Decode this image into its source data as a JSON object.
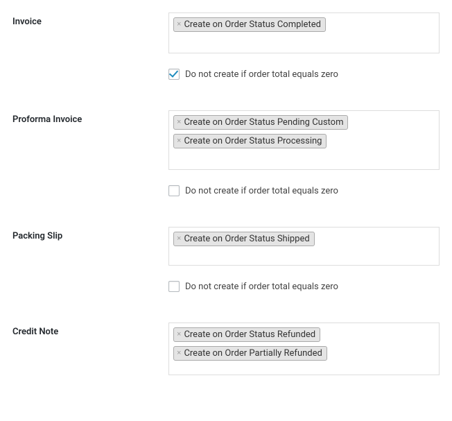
{
  "sections": {
    "invoice": {
      "label": "Invoice",
      "tags": [
        "Create on Order Status Completed"
      ],
      "checkbox_label": "Do not create if order total equals zero",
      "checked": true
    },
    "proforma": {
      "label": "Proforma Invoice",
      "tags": [
        "Create on Order Status Pending Custom",
        "Create on Order Status Processing"
      ],
      "checkbox_label": "Do not create if order total equals zero",
      "checked": false
    },
    "packing": {
      "label": "Packing Slip",
      "tags": [
        "Create on Order Status Shipped"
      ],
      "checkbox_label": "Do not create if order total equals zero",
      "checked": false
    },
    "credit": {
      "label": "Credit Note",
      "tags": [
        "Create on Order Status Refunded",
        "Create on Order Partially Refunded"
      ]
    }
  }
}
